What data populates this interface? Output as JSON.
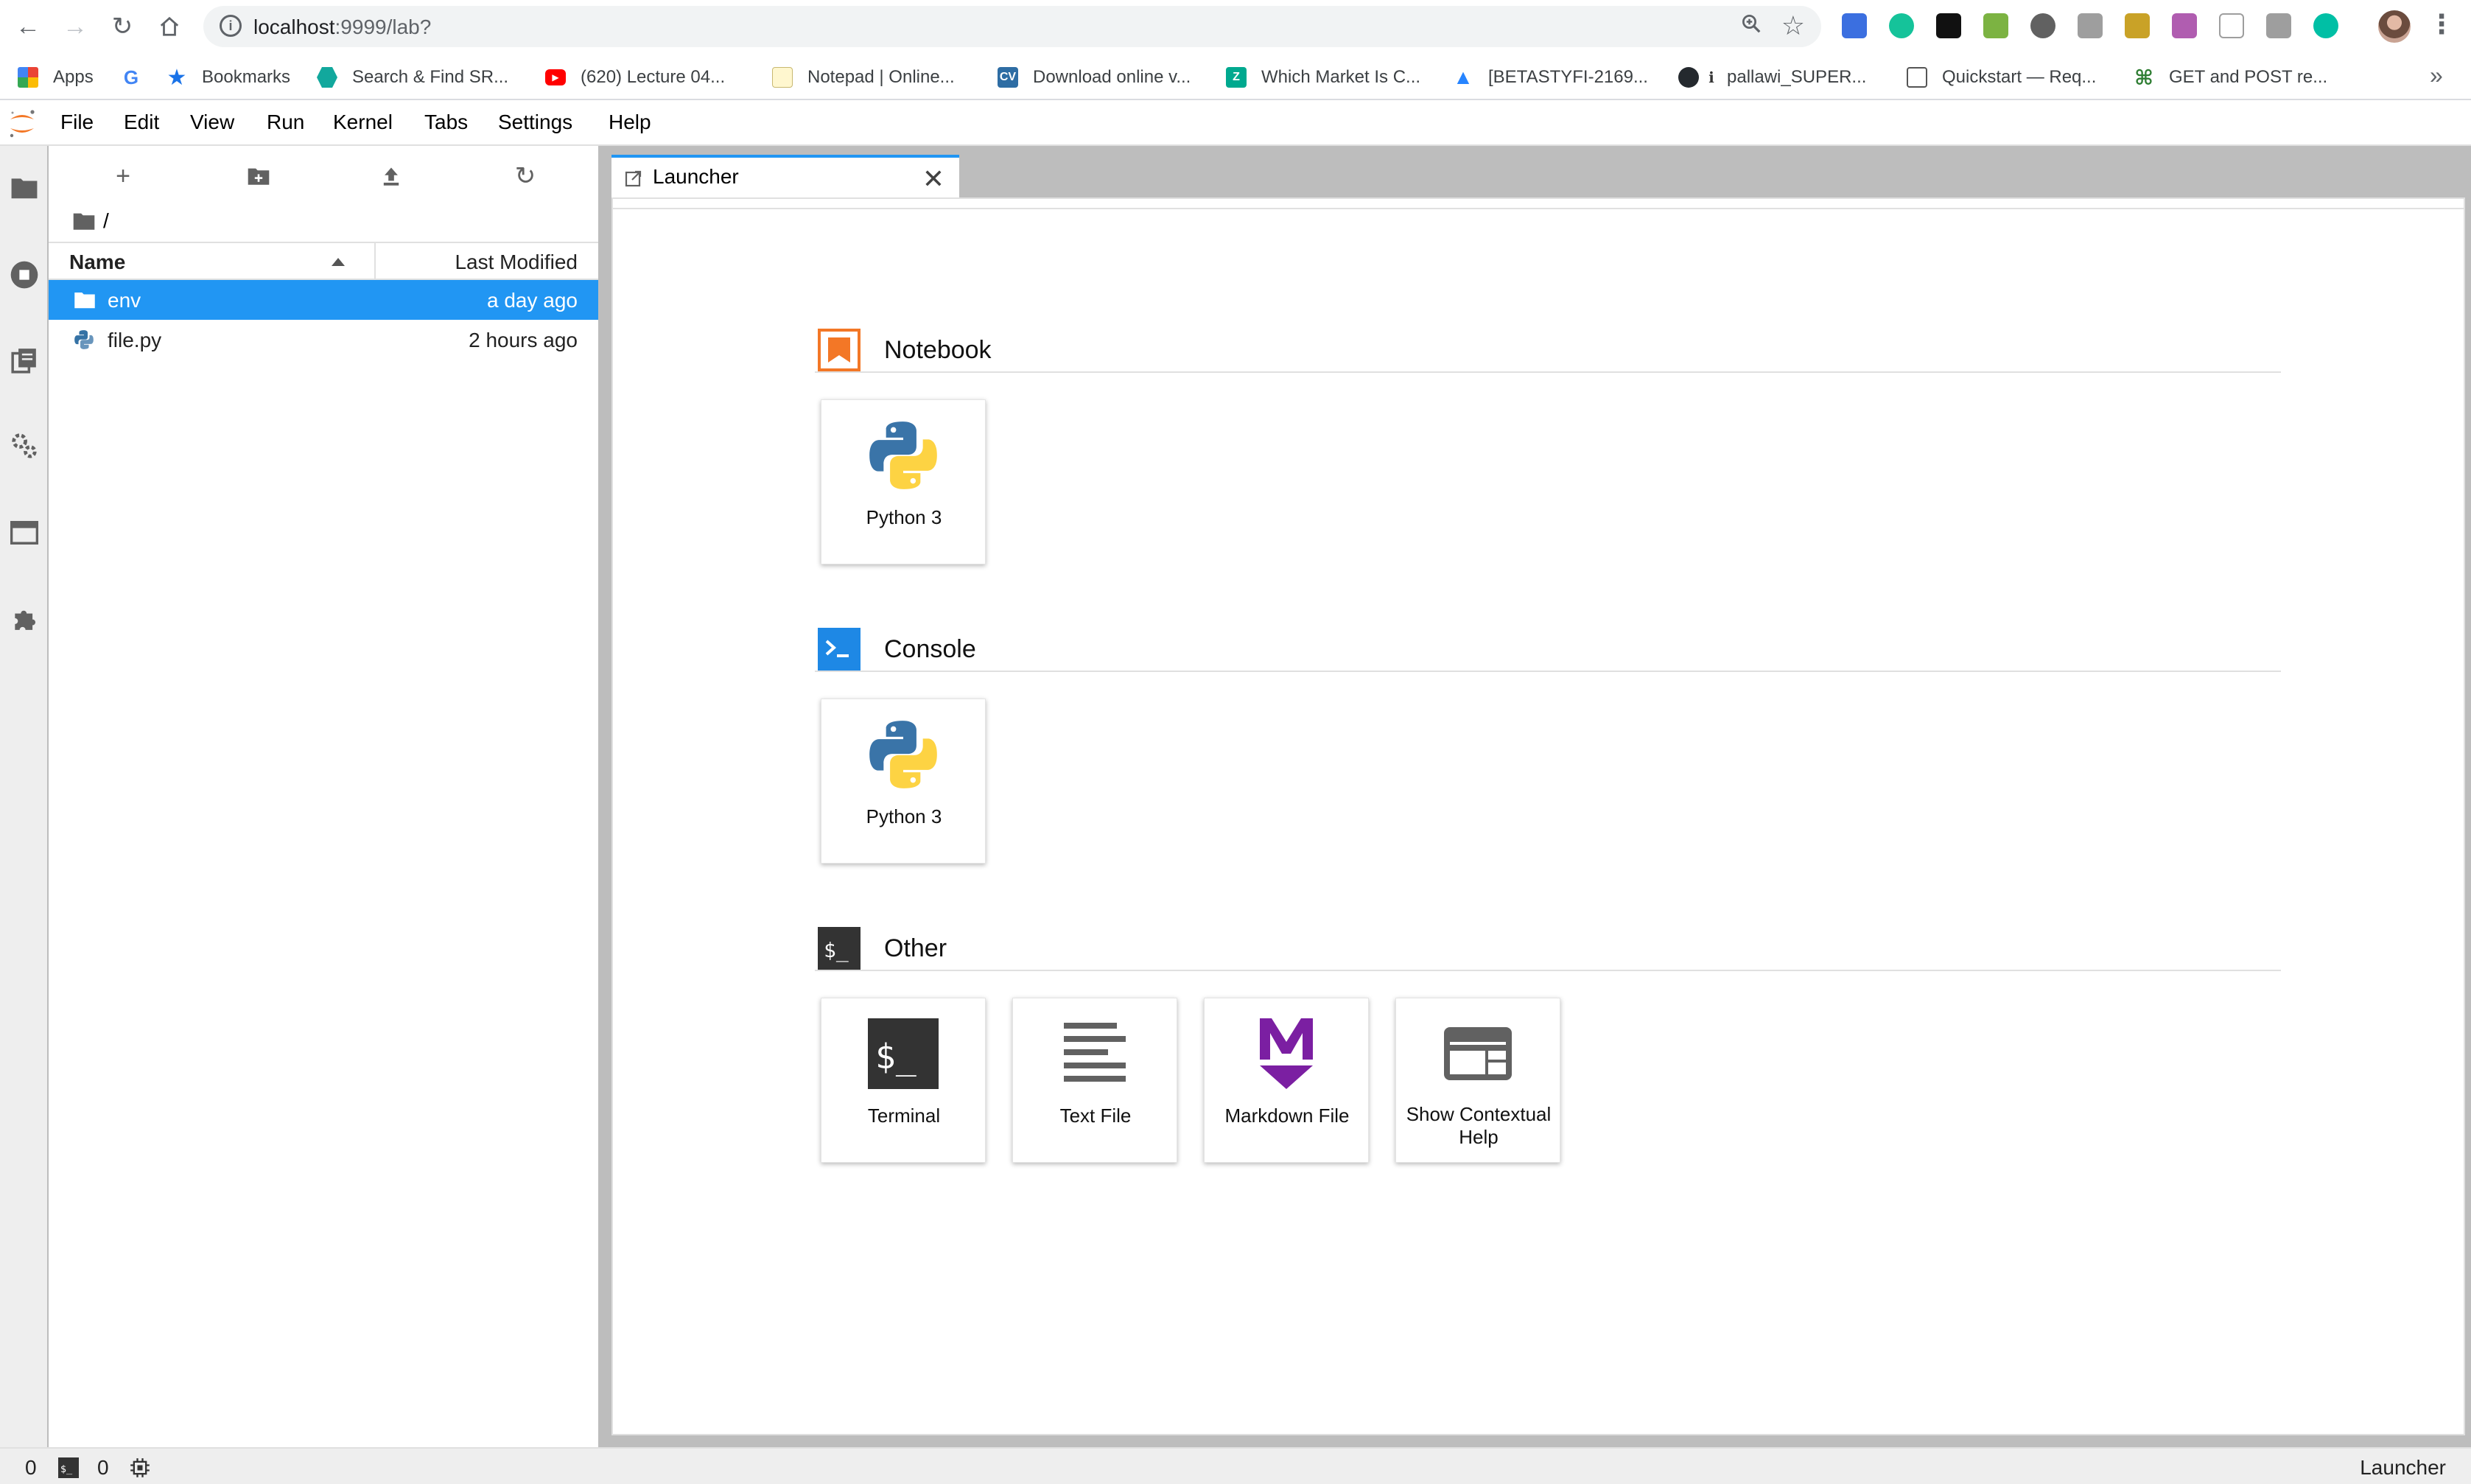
{
  "browser": {
    "url_host": "localhost",
    "url_rest": ":9999/lab?",
    "bookmarks": [
      {
        "label": "Apps"
      },
      {
        "label": "G"
      },
      {
        "label": "Bookmarks"
      },
      {
        "label": "Search & Find SR..."
      },
      {
        "label": "(620) Lecture 04..."
      },
      {
        "label": "Notepad | Online..."
      },
      {
        "label": "Download online v..."
      },
      {
        "label": "Which Market Is C..."
      },
      {
        "label": "[BETASTYFI-2169..."
      },
      {
        "label": "pallawi_SUPER..."
      },
      {
        "label": "Quickstart — Req..."
      },
      {
        "label": "GET and POST re..."
      }
    ],
    "more": "»"
  },
  "menubar": {
    "items": [
      "File",
      "Edit",
      "View",
      "Run",
      "Kernel",
      "Tabs",
      "Settings",
      "Help"
    ]
  },
  "filebrowser": {
    "breadcrumb": "/",
    "columns": {
      "name": "Name",
      "modified": "Last Modified"
    },
    "rows": [
      {
        "name": "env",
        "modified": "a day ago",
        "type": "folder",
        "selected": true
      },
      {
        "name": "file.py",
        "modified": "2 hours ago",
        "type": "python",
        "selected": false
      }
    ]
  },
  "tabs": [
    {
      "label": "Launcher"
    }
  ],
  "launcher": {
    "sections": [
      {
        "title": "Notebook",
        "cards": [
          {
            "label": "Python 3"
          }
        ]
      },
      {
        "title": "Console",
        "cards": [
          {
            "label": "Python 3"
          }
        ]
      },
      {
        "title": "Other",
        "cards": [
          {
            "label": "Terminal"
          },
          {
            "label": "Text File"
          },
          {
            "label": "Markdown File"
          },
          {
            "label": "Show Contextual Help"
          }
        ]
      }
    ]
  },
  "statusbar": {
    "kernels": "0",
    "terminals": "0",
    "right": "Launcher"
  },
  "colors": {
    "accent": "#2196f3",
    "jupyter_orange": "#f37726",
    "markdown_purple": "#7b1fa2"
  }
}
